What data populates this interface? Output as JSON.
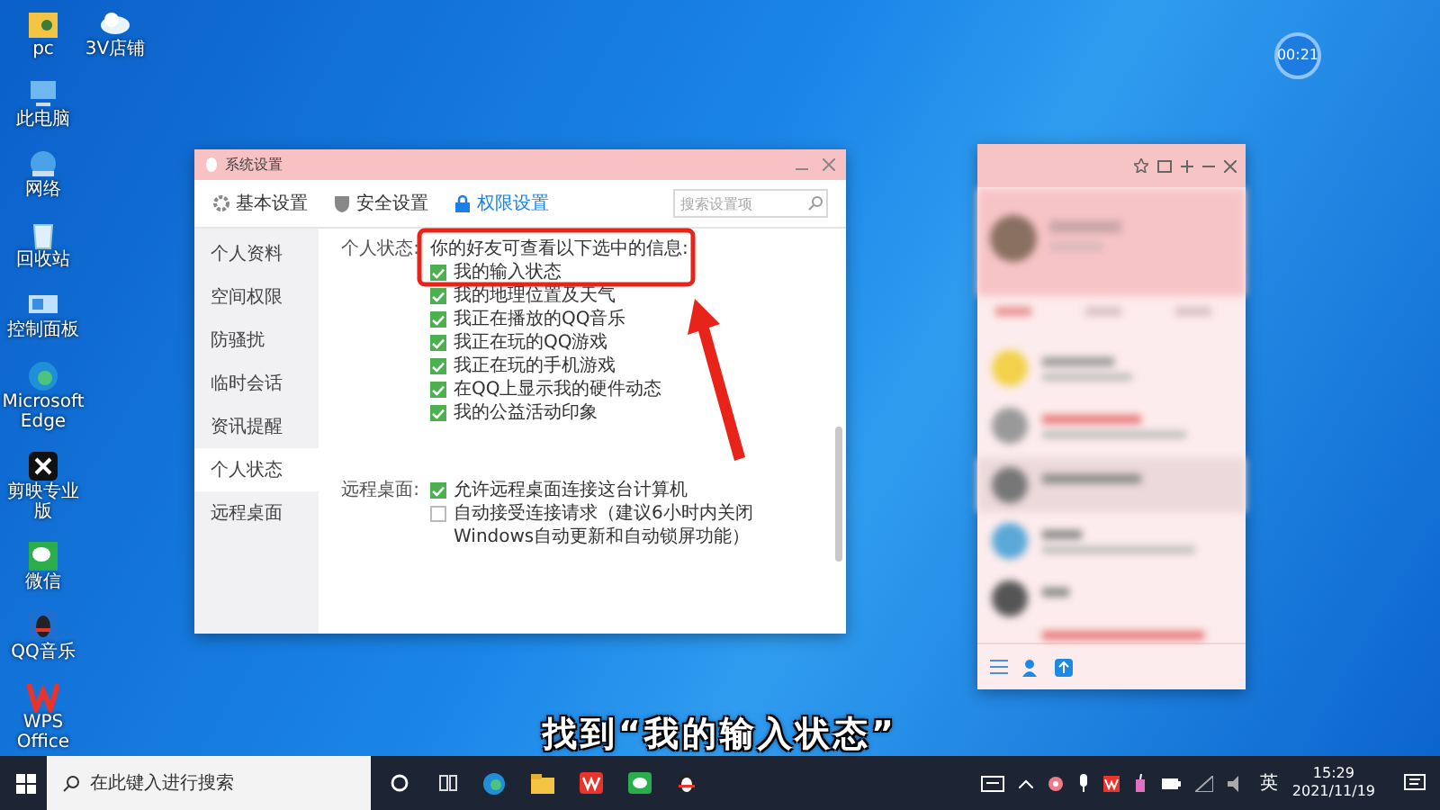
{
  "desktop_icons": [
    {
      "label": "pc",
      "kind": "user-folder"
    },
    {
      "label": "3V店铺",
      "kind": "cloud"
    },
    {
      "label": "此电脑",
      "kind": "computer"
    },
    {
      "label": "网络",
      "kind": "network"
    },
    {
      "label": "回收站",
      "kind": "recycle-bin"
    },
    {
      "label": "控制面板",
      "kind": "control-panel"
    },
    {
      "label": "Microsoft Edge",
      "kind": "edge"
    },
    {
      "label": "剪映专业版",
      "kind": "capcut"
    },
    {
      "label": "微信",
      "kind": "wechat"
    },
    {
      "label": "QQ音乐",
      "kind": "qq"
    },
    {
      "label": "WPS Office",
      "kind": "wps"
    }
  ],
  "recording_timer": "00:21",
  "settings_window": {
    "title": "系统设置",
    "tabs": [
      {
        "label": "基本设置",
        "kind": "gear",
        "selected": false
      },
      {
        "label": "安全设置",
        "kind": "shield",
        "selected": false
      },
      {
        "label": "权限设置",
        "kind": "lock",
        "selected": true
      }
    ],
    "search": {
      "placeholder": "搜索设置项"
    },
    "sidebar": [
      {
        "label": "个人资料",
        "selected": false
      },
      {
        "label": "空间权限",
        "selected": false
      },
      {
        "label": "防骚扰",
        "selected": false
      },
      {
        "label": "临时会话",
        "selected": false
      },
      {
        "label": "资讯提醒",
        "selected": false
      },
      {
        "label": "个人状态",
        "selected": true
      },
      {
        "label": "远程桌面",
        "selected": false
      }
    ],
    "sections": [
      {
        "label": "个人状态:",
        "intro": "你的好友可查看以下选中的信息:",
        "options": [
          {
            "label": "我的输入状态",
            "checked": true
          },
          {
            "label": "我的地理位置及天气",
            "checked": true
          },
          {
            "label": "我正在播放的QQ音乐",
            "checked": true
          },
          {
            "label": "我正在玩的QQ游戏",
            "checked": true
          },
          {
            "label": "我正在玩的手机游戏",
            "checked": true
          },
          {
            "label": "在QQ上显示我的硬件动态",
            "checked": true
          },
          {
            "label": "我的公益活动印象",
            "checked": true
          }
        ]
      },
      {
        "label": "远程桌面:",
        "options": [
          {
            "label": "允许远程桌面连接这台计算机",
            "checked": true
          },
          {
            "label": "自动接受连接请求（建议6小时内关闭Windows自动更新和自动锁屏功能）",
            "checked": false
          }
        ]
      }
    ]
  },
  "subtitle": "找到“我的输入状态”",
  "taskbar": {
    "search": {
      "placeholder": "在此键入进行搜索"
    },
    "language": "英",
    "time": "15:29",
    "date": "2021/11/19"
  }
}
